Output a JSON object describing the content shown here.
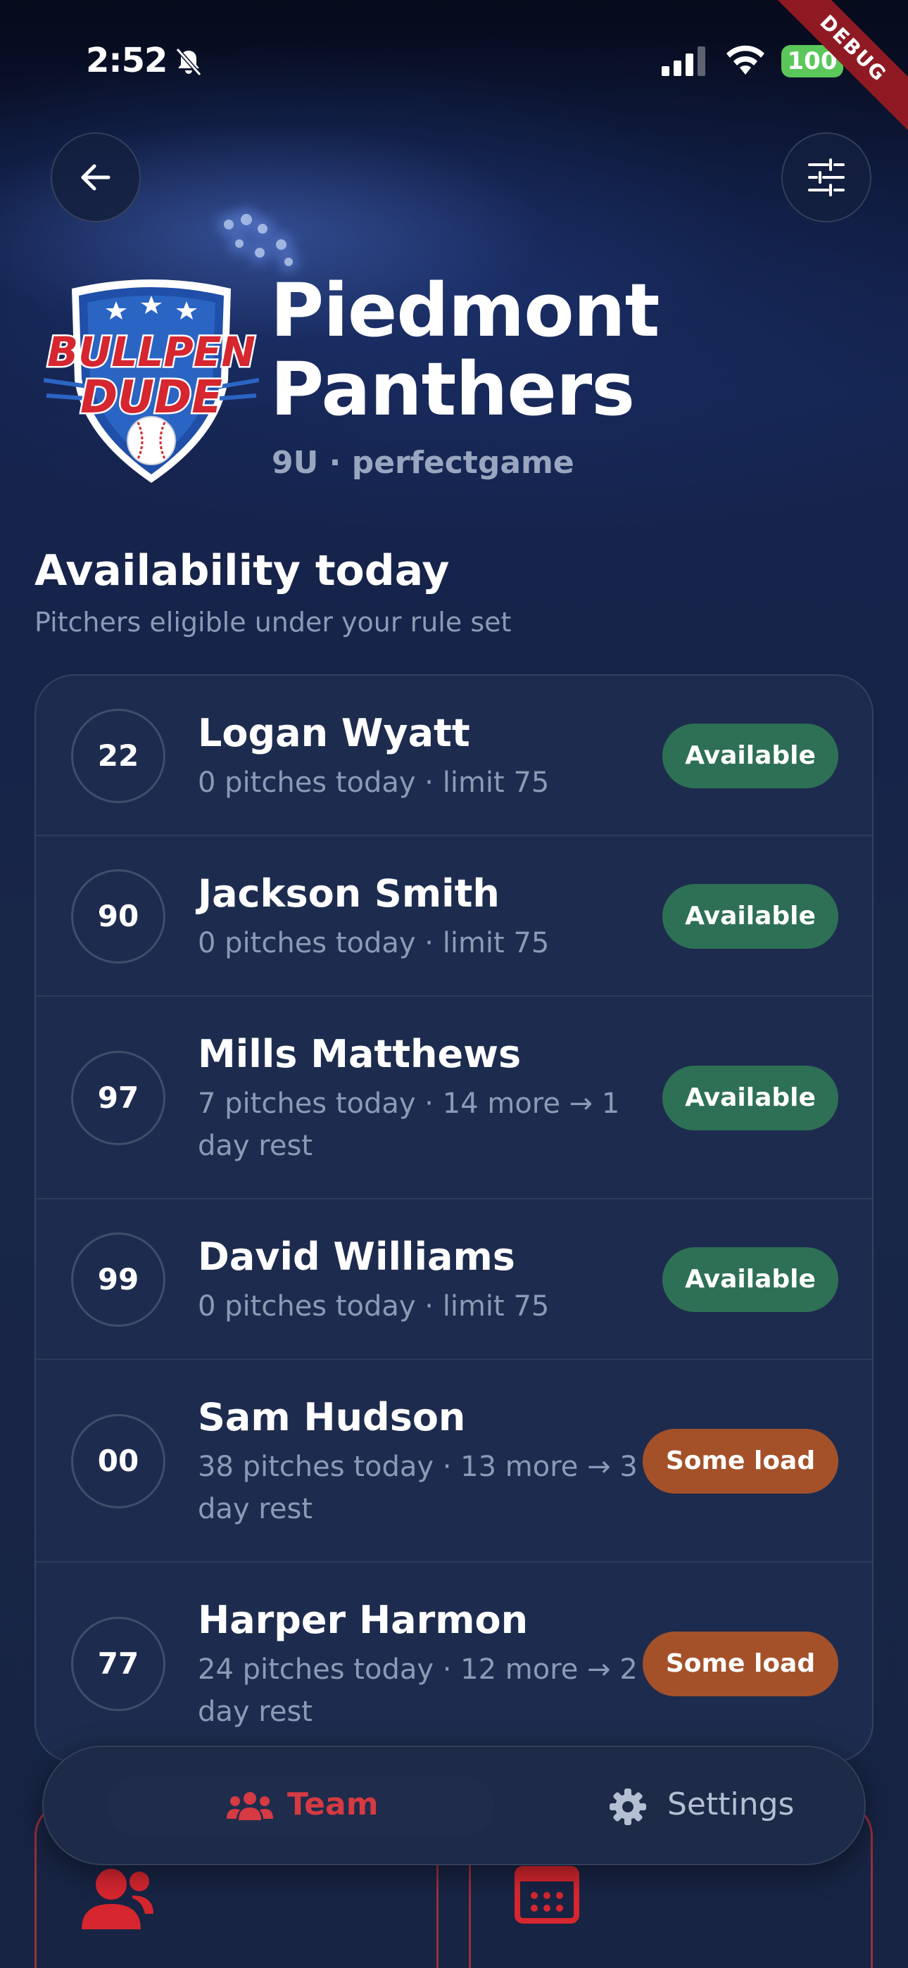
{
  "status_bar": {
    "time": "2:52",
    "battery": "100",
    "icons": [
      "bell-slash-icon",
      "signal-icon",
      "wifi-icon",
      "battery-icon"
    ]
  },
  "debug_label": "DEBUG",
  "header": {
    "back_icon": "arrow-left-icon",
    "filter_icon": "sliders-icon"
  },
  "logo": {
    "line1": "BULLPEN",
    "line2": "DUDE"
  },
  "team": {
    "name_line1": "Piedmont",
    "name_line2": "Panthers",
    "subtitle": "9U · perfectgame"
  },
  "availability": {
    "title": "Availability today",
    "subtitle": "Pitchers eligible under your rule set",
    "players": [
      {
        "number": "22",
        "name": "Logan Wyatt",
        "detail": "0 pitches today · limit 75",
        "status": "Available"
      },
      {
        "number": "90",
        "name": "Jackson Smith",
        "detail": "0 pitches today · limit 75",
        "status": "Available"
      },
      {
        "number": "97",
        "name": "Mills Matthews",
        "detail": "7 pitches today · 14 more → 1 day rest",
        "status": "Available"
      },
      {
        "number": "99",
        "name": "David Williams",
        "detail": "0 pitches today · limit 75",
        "status": "Available"
      },
      {
        "number": "00",
        "name": "Sam Hudson",
        "detail": "38 pitches today · 13 more → 3 day rest",
        "status": "Some load"
      },
      {
        "number": "77",
        "name": "Harper Harmon",
        "detail": "24 pitches today · 12 more → 2 day rest",
        "status": "Some load"
      }
    ]
  },
  "nav": {
    "team_label": "Team",
    "settings_label": "Settings",
    "active": "Team"
  },
  "colors": {
    "available": "#2e7055",
    "some_load": "#a4512a",
    "accent_red": "#d63a42",
    "battery_green": "#5bc75a"
  }
}
